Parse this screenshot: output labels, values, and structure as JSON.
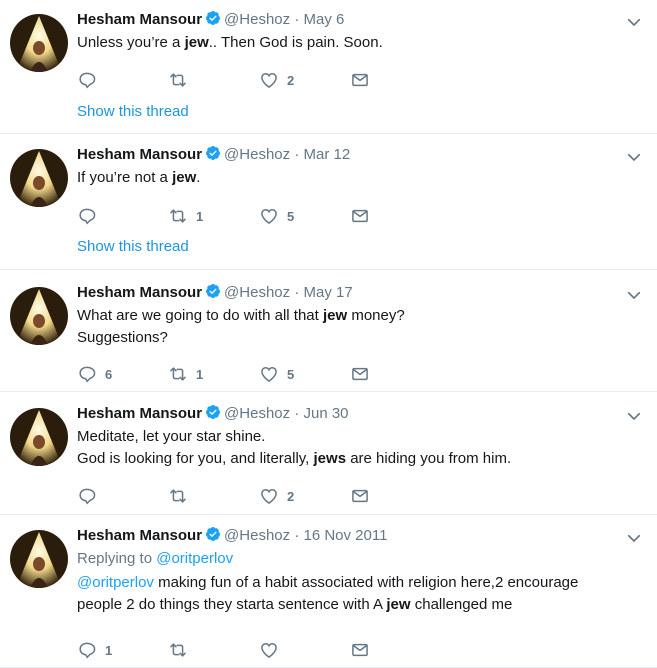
{
  "tweets": [
    {
      "name": "Hesham Mansour",
      "handle": "@Heshoz",
      "dot": "·",
      "time": "May 6",
      "text_parts": [
        {
          "t": "Unless you’re a ",
          "b": false
        },
        {
          "t": "jew",
          "b": true
        },
        {
          "t": ".. Then God is pain. Soon.",
          "b": false
        }
      ],
      "replies": "",
      "retweets": "",
      "likes": "2",
      "show_thread": "Show this thread"
    },
    {
      "name": "Hesham Mansour",
      "handle": "@Heshoz",
      "dot": "·",
      "time": "Mar 12",
      "text_parts": [
        {
          "t": "If you’re not a ",
          "b": false
        },
        {
          "t": "jew",
          "b": true
        },
        {
          "t": ".",
          "b": false
        }
      ],
      "replies": "",
      "retweets": "1",
      "likes": "5",
      "show_thread": "Show this thread"
    },
    {
      "name": "Hesham Mansour",
      "handle": "@Heshoz",
      "dot": "·",
      "time": "May 17",
      "text_parts": [
        {
          "t": "What are we going to do with all that ",
          "b": false
        },
        {
          "t": "jew",
          "b": true
        },
        {
          "t": " money?\nSuggestions?",
          "b": false
        }
      ],
      "replies": "6",
      "retweets": "1",
      "likes": "5",
      "show_thread": ""
    },
    {
      "name": "Hesham Mansour",
      "handle": "@Heshoz",
      "dot": "·",
      "time": "Jun 30",
      "text_parts": [
        {
          "t": "Meditate, let your star shine.\nGod is looking for you, and literally, ",
          "b": false
        },
        {
          "t": "jews",
          "b": true
        },
        {
          "t": " are hiding you from him.",
          "b": false
        }
      ],
      "replies": "",
      "retweets": "",
      "likes": "2",
      "show_thread": ""
    },
    {
      "name": "Hesham Mansour",
      "handle": "@Heshoz",
      "dot": "·",
      "time": "16 Nov 2011",
      "replying_label": "Replying to ",
      "replying_to": "@oritperlov",
      "mention": "@oritperlov",
      "text_parts": [
        {
          "t": " making fun of a habit associated with religion here,2 encourage\npeople 2 do things they starta sentence with A ",
          "b": false
        },
        {
          "t": "jew",
          "b": true
        },
        {
          "t": " challenged me",
          "b": false
        }
      ],
      "replies": "1",
      "retweets": "",
      "likes": "",
      "show_thread": ""
    }
  ],
  "icons": [
    "reply-icon",
    "retweet-icon",
    "like-icon",
    "dm-icon",
    "verified-badge-icon",
    "caret-down-icon"
  ],
  "colors": {
    "accent": "#1da1f2",
    "muted": "#657786",
    "text": "#14171a",
    "verified": "#1da1f2"
  }
}
